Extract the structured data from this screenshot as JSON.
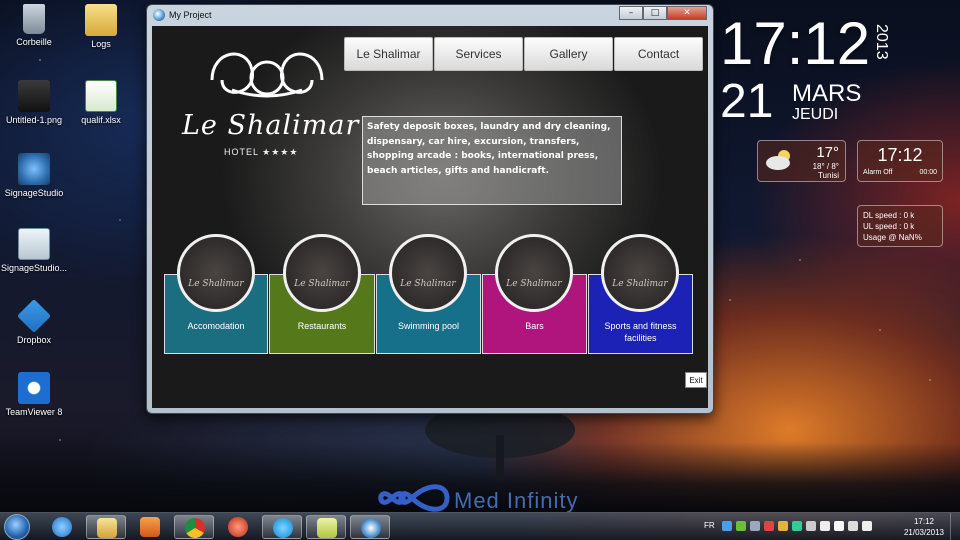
{
  "desktop": {
    "icons": [
      {
        "label": "Corbeille"
      },
      {
        "label": "Logs"
      },
      {
        "label": "Untitled-1.png"
      },
      {
        "label": "qualif.xlsx"
      },
      {
        "label": "SignageStudio"
      },
      {
        "label": "SignageStudio..."
      },
      {
        "label": "Dropbox"
      },
      {
        "label": "TeamViewer 8"
      }
    ],
    "watermark_text": "Med Infinity"
  },
  "gadgets": {
    "clock": {
      "time": "17:12",
      "year": "2013",
      "day": "21",
      "month": "MARS",
      "weekday": "JEUDI"
    },
    "weather": {
      "temperature": "17°",
      "range": "18° / 8°",
      "city": "Tunisi"
    },
    "alarm": {
      "time": "17:12",
      "status": "Alarm Off",
      "alarm_time": "00:00"
    },
    "network": {
      "dl": "DL speed : 0 k",
      "ul": "UL speed : 0 k",
      "usage": "Usage @ NaN%"
    }
  },
  "window": {
    "title": "My Project",
    "controls": {
      "minimize": "–",
      "maximize": "□",
      "close": "✕"
    },
    "brand": {
      "name": "Le Shalimar",
      "subtitle": "HOTEL ★★★★"
    },
    "nav": [
      "Le Shalimar",
      "Services",
      "Gallery",
      "Contact"
    ],
    "description": "Safety deposit boxes, laundry and dry cleaning, dispensary, car hire, excursion, transfers, shopping arcade : books, international press, beach articles, gifts and handicraft.",
    "categories": [
      {
        "label": "Accomodation",
        "color": "#1a6e80"
      },
      {
        "label": "Restaurants",
        "color": "#55781a"
      },
      {
        "label": "Swimming pool",
        "color": "#17708a"
      },
      {
        "label": "Bars",
        "color": "#b0157e"
      },
      {
        "label": "Sports and fitness facilities",
        "color": "#1b22b5"
      }
    ],
    "medal_text": "Le Shalimar",
    "exit_label": "Exit"
  },
  "taskbar": {
    "language": "FR",
    "time": "17:12",
    "date": "21/03/2013"
  }
}
